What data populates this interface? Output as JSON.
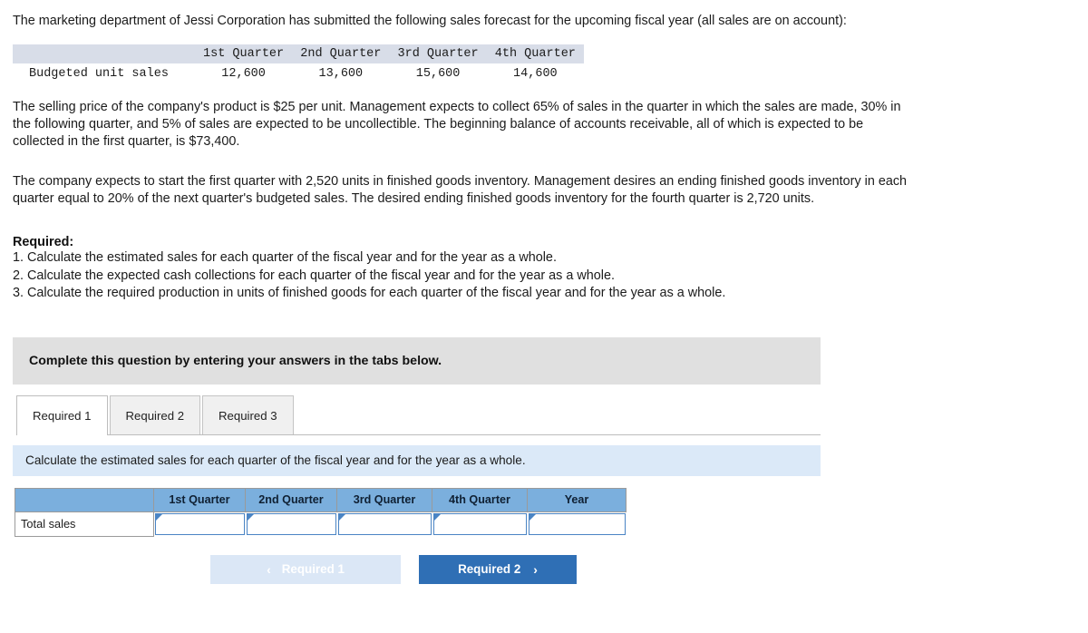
{
  "intro": {
    "paragraph1": "The marketing department of Jessi Corporation has submitted the following sales forecast for the upcoming fiscal year (all sales are on account):",
    "paragraph2": "The selling price of the company's product is $25 per unit. Management expects to collect 65% of sales in the quarter in which the sales are made, 30% in the following quarter, and 5% of sales are expected to be uncollectible. The beginning balance of accounts receivable, all of which is expected to be collected in the first quarter, is $73,400.",
    "paragraph3": "The company expects to start the first quarter with 2,520 units in finished goods inventory. Management desires an ending finished goods inventory in each quarter equal to 20% of the next quarter's budgeted sales. The desired ending finished goods inventory for the fourth quarter is 2,720 units."
  },
  "forecast_table": {
    "corner_label": "",
    "headers": [
      "1st Quarter",
      "2nd Quarter",
      "3rd Quarter",
      "4th Quarter"
    ],
    "rows": [
      {
        "label": "Budgeted unit sales",
        "values": [
          "12,600",
          "13,600",
          "15,600",
          "14,600"
        ]
      }
    ]
  },
  "required": {
    "heading": "Required:",
    "items": [
      "1. Calculate the estimated sales for each quarter of the fiscal year and for the year as a whole.",
      "2. Calculate the expected cash collections for each quarter of the fiscal year and for the year as a whole.",
      "3. Calculate the required production in units of finished goods for each quarter of the fiscal year and for the year as a whole."
    ]
  },
  "banner": {
    "text": "Complete this question by entering your answers in the tabs below."
  },
  "tabs": [
    {
      "label": "Required 1",
      "active": true
    },
    {
      "label": "Required 2",
      "active": false
    },
    {
      "label": "Required 3",
      "active": false
    }
  ],
  "instruction": {
    "text": "Calculate the estimated sales for each quarter of the fiscal year and for the year as a whole."
  },
  "answer_table": {
    "corner_label": "",
    "headers": [
      "1st Quarter",
      "2nd Quarter",
      "3rd Quarter",
      "4th Quarter",
      "Year"
    ],
    "rows": [
      {
        "label": "Total sales",
        "values": [
          "",
          "",
          "",
          "",
          ""
        ]
      }
    ]
  },
  "nav": {
    "prev_label": "Required 1",
    "prev_chevron": "‹",
    "next_label": "Required 2",
    "next_chevron": "›"
  },
  "colors": {
    "banner_bg": "#e0e0e0",
    "instruction_bg": "#dbe9f8",
    "table_header_blue": "#7bafdd",
    "input_border_blue": "#4a84c4",
    "button_primary": "#2f6fb5",
    "button_disabled": "#dbe7f6",
    "forecast_header_bg": "#d8dde8"
  }
}
